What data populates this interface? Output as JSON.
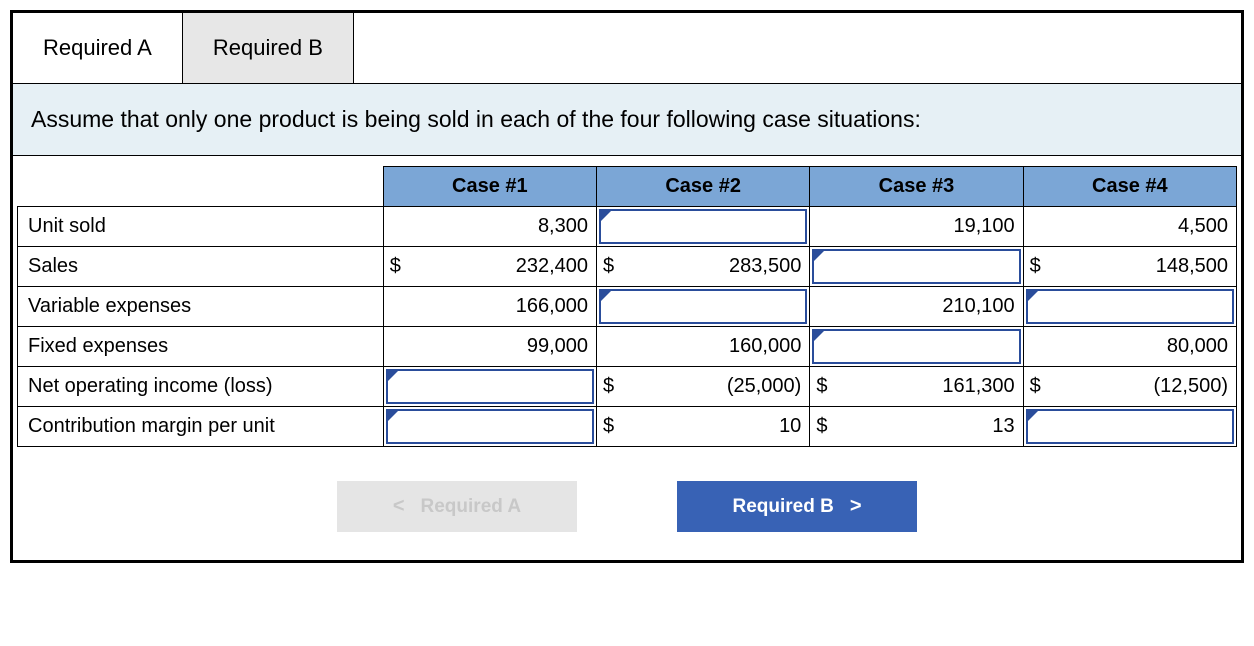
{
  "tabs": {
    "a": "Required A",
    "b": "Required B"
  },
  "instruction": "Assume that only one product is being sold in each of the four following case situations:",
  "headers": {
    "c1": "Case #1",
    "c2": "Case #2",
    "c3": "Case #3",
    "c4": "Case #4"
  },
  "dollar": "$",
  "rows": {
    "unit_sold": {
      "label": "Unit sold",
      "c1": {
        "value": "8,300"
      },
      "c2": {
        "input": true
      },
      "c3": {
        "value": "19,100"
      },
      "c4": {
        "value": "4,500"
      }
    },
    "sales": {
      "label": "Sales",
      "c1": {
        "dollar": true,
        "value": "232,400"
      },
      "c2": {
        "dollar": true,
        "value": "283,500"
      },
      "c3": {
        "input": true
      },
      "c4": {
        "dollar": true,
        "value": "148,500"
      }
    },
    "var_exp": {
      "label": "Variable expenses",
      "c1": {
        "value": "166,000"
      },
      "c2": {
        "input": true
      },
      "c3": {
        "value": "210,100"
      },
      "c4": {
        "input": true
      }
    },
    "fix_exp": {
      "label": "Fixed expenses",
      "c1": {
        "value": "99,000"
      },
      "c2": {
        "value": "160,000"
      },
      "c3": {
        "input": true
      },
      "c4": {
        "value": "80,000"
      }
    },
    "noi": {
      "label": "Net operating income (loss)",
      "c1": {
        "input": true
      },
      "c2": {
        "dollar": true,
        "value": "(25,000)"
      },
      "c3": {
        "dollar": true,
        "value": "161,300"
      },
      "c4": {
        "dollar": true,
        "value": "(12,500)"
      }
    },
    "cm_unit": {
      "label": "Contribution margin per unit",
      "c1": {
        "input": true
      },
      "c2": {
        "dollar": true,
        "value": "10"
      },
      "c3": {
        "dollar": true,
        "value": "13"
      },
      "c4": {
        "input": true
      }
    }
  },
  "nav": {
    "prev": "Required A",
    "next": "Required B"
  }
}
